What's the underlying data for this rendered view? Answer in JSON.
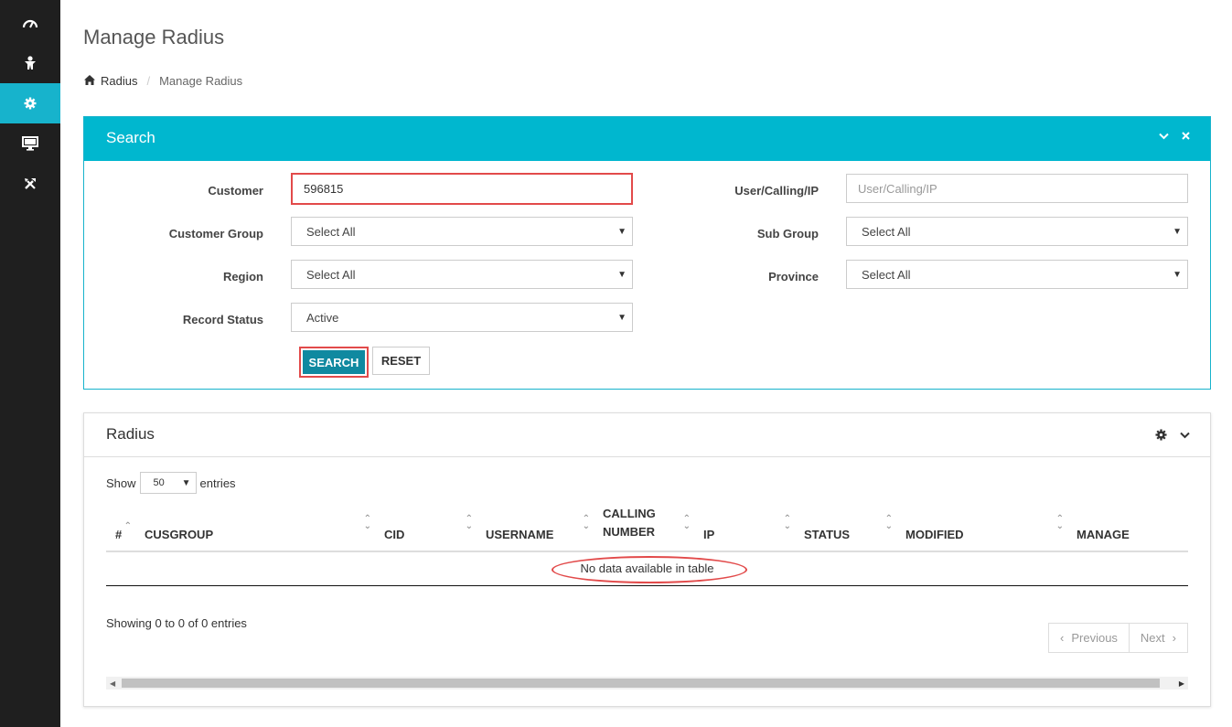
{
  "sidebar": {
    "items": [
      {
        "icon": "dashboard-icon"
      },
      {
        "icon": "user-icon"
      },
      {
        "icon": "gear-icon",
        "active": true
      },
      {
        "icon": "monitor-icon"
      },
      {
        "icon": "tools-icon"
      }
    ]
  },
  "header": {
    "title": "Manage Radius",
    "breadcrumb": {
      "home_label": "Radius",
      "separator": "/",
      "current": "Manage Radius"
    }
  },
  "search_panel": {
    "title": "Search",
    "fields": {
      "customer": {
        "label": "Customer",
        "value": "596815"
      },
      "user_calling_ip": {
        "label": "User/Calling/IP",
        "placeholder": "User/Calling/IP",
        "value": ""
      },
      "customer_group": {
        "label": "Customer Group",
        "value": "Select All"
      },
      "sub_group": {
        "label": "Sub Group",
        "value": "Select All"
      },
      "region": {
        "label": "Region",
        "value": "Select All"
      },
      "province": {
        "label": "Province",
        "value": "Select All"
      },
      "record_status": {
        "label": "Record Status",
        "value": "Active"
      }
    },
    "search_button": "SEARCH",
    "reset_button": "RESET"
  },
  "radius_panel": {
    "title": "Radius",
    "show_label": "Show",
    "page_length": "50",
    "entries_label": "entries",
    "columns": [
      "#",
      "CUSGROUP",
      "CID",
      "USERNAME",
      "CALLING NUMBER",
      "IP",
      "STATUS",
      "MODIFIED",
      "MANAGE"
    ],
    "empty_message": "No data available in table",
    "info": "Showing 0 to 0 of 0 entries",
    "previous_label": "Previous",
    "next_label": "Next"
  },
  "colors": {
    "accent": "#00b7cf",
    "sidebar": "#1f1f1f",
    "highlight": "#e24a4a",
    "search_button": "#1089a0"
  }
}
